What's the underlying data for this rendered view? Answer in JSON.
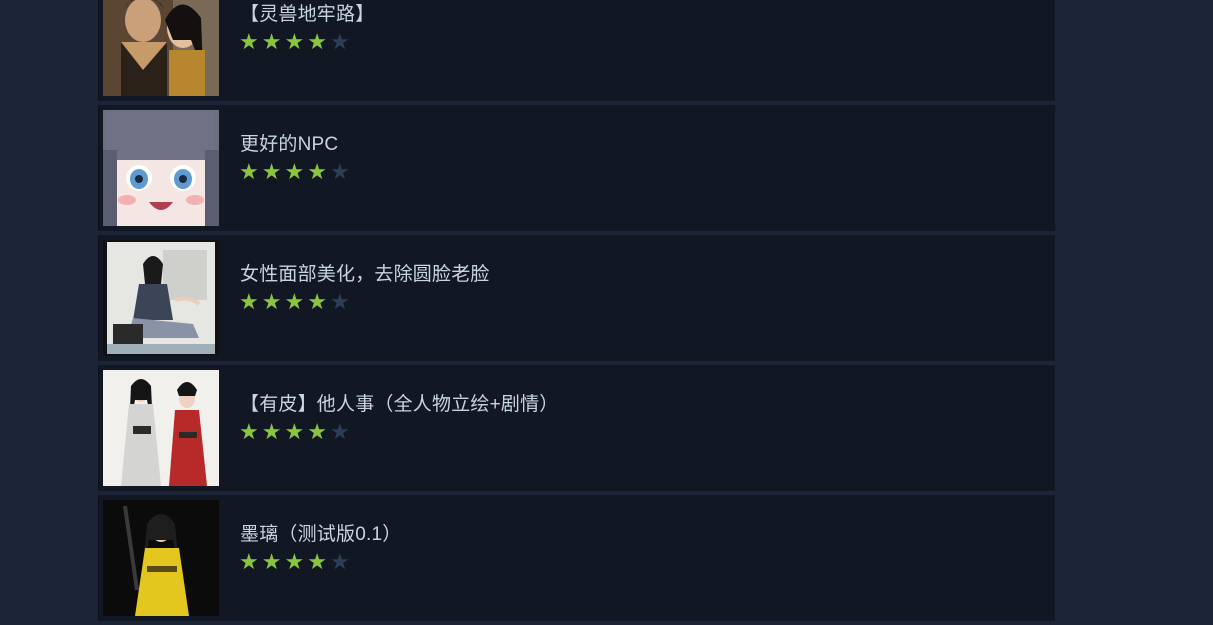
{
  "colors": {
    "background": "#1b2537",
    "row_background": "#121823",
    "star_filled": "#8bc53f",
    "star_empty": "#2c3e57",
    "title_text": "#c7d5e0"
  },
  "items": [
    {
      "title": "【灵兽地牢路】",
      "rating": 4,
      "max_rating": 5,
      "thumb": "couple-portrait"
    },
    {
      "title": "更好的NPC",
      "rating": 4,
      "max_rating": 5,
      "thumb": "anime-girl-face"
    },
    {
      "title": "女性面部美化，去除圆脸老脸",
      "rating": 4,
      "max_rating": 5,
      "thumb": "seated-woman"
    },
    {
      "title": "【有皮】他人事（全人物立绘+剧情）",
      "rating": 4,
      "max_rating": 5,
      "thumb": "two-women-standing"
    },
    {
      "title": "墨璃（测试版0.1）",
      "rating": 4,
      "max_rating": 5,
      "thumb": "woman-yellow-robe"
    }
  ]
}
